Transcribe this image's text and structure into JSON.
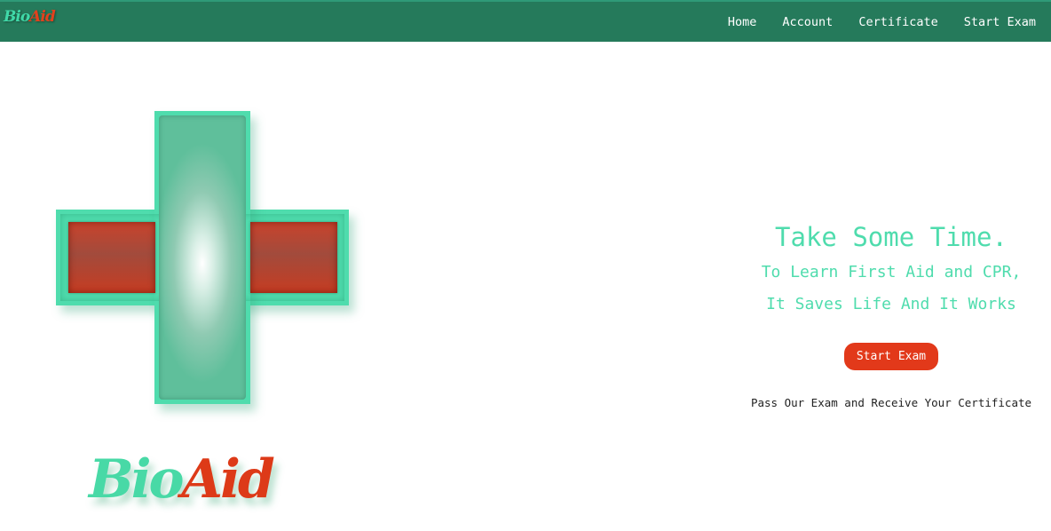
{
  "nav": {
    "logo_bio": "Bio",
    "logo_aid": "Aid",
    "links": [
      "Home",
      "Account",
      "Certificate",
      "Start Exam"
    ]
  },
  "logo": {
    "bio": "Bio",
    "aid": "Aid"
  },
  "hero": {
    "title": "Take Some Time.",
    "line1": "To Learn First Aid and CPR,",
    "line2": "It Saves Life And It Works",
    "button": "Start Exam",
    "note": "Pass Our Exam and Receive Your Certificate"
  },
  "colors": {
    "navbar": "#257a5b",
    "accent_green": "#4fdcad",
    "accent_red": "#e2391a"
  },
  "icons": {
    "hero_image": "medical-cross-icon"
  }
}
